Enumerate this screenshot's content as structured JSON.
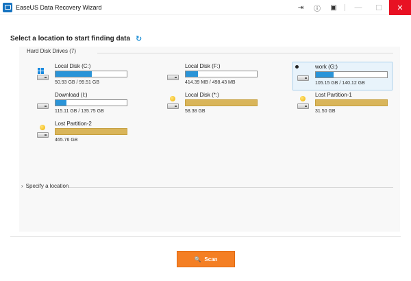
{
  "window": {
    "title": "EaseUS Data Recovery Wizard"
  },
  "toolbar": {
    "icons": [
      "import-icon",
      "info-icon",
      "menu-icon"
    ],
    "import_glyph": "⇥",
    "info_glyph": "ⓘ",
    "menu_glyph": "▣",
    "minimize_glyph": "—",
    "maximize_glyph": "☐",
    "close_glyph": "✕"
  },
  "main": {
    "heading": "Select a location to start finding data",
    "refresh_glyph": "↻"
  },
  "hard_disk_group": {
    "title": "Hard Disk Drives (7)",
    "drives": [
      {
        "name": "Local Disk (C:)",
        "size": "50.93 GB / 99.51 GB",
        "used_fraction": 0.51,
        "type": "system",
        "selected": false
      },
      {
        "name": "Local Disk (F:)",
        "size": "414.39 MB / 498.43 MB",
        "used_fraction": 0.17,
        "type": "disk",
        "selected": false
      },
      {
        "name": "work (G:)",
        "size": "105.15 GB / 140.12 GB",
        "used_fraction": 0.25,
        "type": "disk",
        "selected": true
      },
      {
        "name": "Download (I:)",
        "size": "115.11 GB / 135.75 GB",
        "used_fraction": 0.15,
        "type": "disk",
        "selected": false
      },
      {
        "name": "Local Disk (*:)",
        "size": "58.38 GB",
        "used_fraction": 1.0,
        "type": "partition",
        "selected": false
      },
      {
        "name": "Lost Partition-1",
        "size": "31.50 GB",
        "used_fraction": 1.0,
        "type": "partition",
        "selected": false
      },
      {
        "name": "Lost Partition-2",
        "size": "465.76 GB",
        "used_fraction": 1.0,
        "type": "partition",
        "selected": false
      }
    ]
  },
  "specify": {
    "label": "Specify a location",
    "chevron_glyph": "›"
  },
  "scan": {
    "label": "Scan",
    "icon_glyph": "🔍"
  },
  "colors": {
    "accent": "#f47f24",
    "bar_fill": "#2a94d8",
    "partition_bar": "#d9b55a",
    "close_button": "#e81123",
    "refresh": "#1e8fd6"
  }
}
